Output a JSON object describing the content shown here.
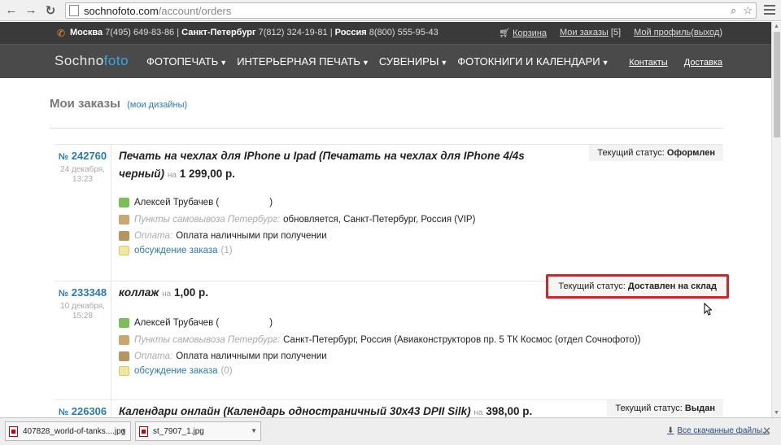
{
  "browser": {
    "url_host": "sochnofoto.com",
    "url_path": "/account/orders"
  },
  "topbar": {
    "moscow_label": "Москва",
    "moscow_phone": "7(495) 649-83-86",
    "spb_label": "Санкт-Петербург",
    "spb_phone": "7(812) 324-19-81",
    "russia_label": "Россия",
    "russia_phone": "8(800) 555-95-43",
    "sep": "|",
    "cart": "Корзина",
    "my_orders": "Мои заказы",
    "my_orders_count": "[5]",
    "my_profile": "Мой профиль",
    "logout": "выход"
  },
  "nav": {
    "logo_main": "Sochno",
    "logo_accent": "foto",
    "menu": [
      {
        "label": "ФОТОПЕЧАТЬ"
      },
      {
        "label": "ИНТЕРЬЕРНАЯ ПЕЧАТЬ"
      },
      {
        "label": "СУВЕНИРЫ"
      },
      {
        "label": "ФОТОКНИГИ И КАЛЕНДАРИ"
      }
    ],
    "contacts": "Контакты",
    "delivery": "Доставка"
  },
  "page": {
    "title": "Мои заказы",
    "designs_link": "мои дизайны"
  },
  "labels": {
    "num_sign": "№",
    "na": "на",
    "status_label": "Текущий статус:",
    "pickup_label": "Пункты самовывоза Петербург:",
    "payment_label": "Оплата:",
    "discussion": "обсуждение заказа"
  },
  "orders": [
    {
      "number": "242760",
      "date": "24 декабря,",
      "time": "13:23",
      "title": "Печать на чехлах для IPhone и Ipad (Печатать на чехлах для IPhone 4/4s черный)",
      "price": "1 299,00 р.",
      "status": "Оформлен",
      "customer": "Алексей Трубачев (",
      "customer_end": ")",
      "pickup": "обновляется, Санкт-Петербург, Россия (VIP)",
      "payment": "Оплата наличными при получении",
      "discussion_count": "(1)"
    },
    {
      "number": "233348",
      "date": "10 декабря,",
      "time": "15:28",
      "title": "коллаж",
      "price": "1,00 р.",
      "status": "Доставлен на склад",
      "customer": "Алексей Трубачев (",
      "customer_end": ")",
      "pickup": "Санкт-Петербург, Россия (Авиаконструкторов пр. 5 ТК Космос (отдел Сочнофото))",
      "payment": "Оплата наличными при получении",
      "discussion_count": "(0)"
    },
    {
      "number": "226306",
      "title": "Календари онлайн (Календарь одностраничный 30х43 DPII Silk)",
      "price": "398,00 р.",
      "status": "Выдан"
    }
  ],
  "downloads": {
    "items": [
      {
        "name": "407828_world-of-tanks....jpg"
      },
      {
        "name": "st_7907_1.jpg"
      }
    ],
    "all": "Все скачанные файлы..."
  }
}
